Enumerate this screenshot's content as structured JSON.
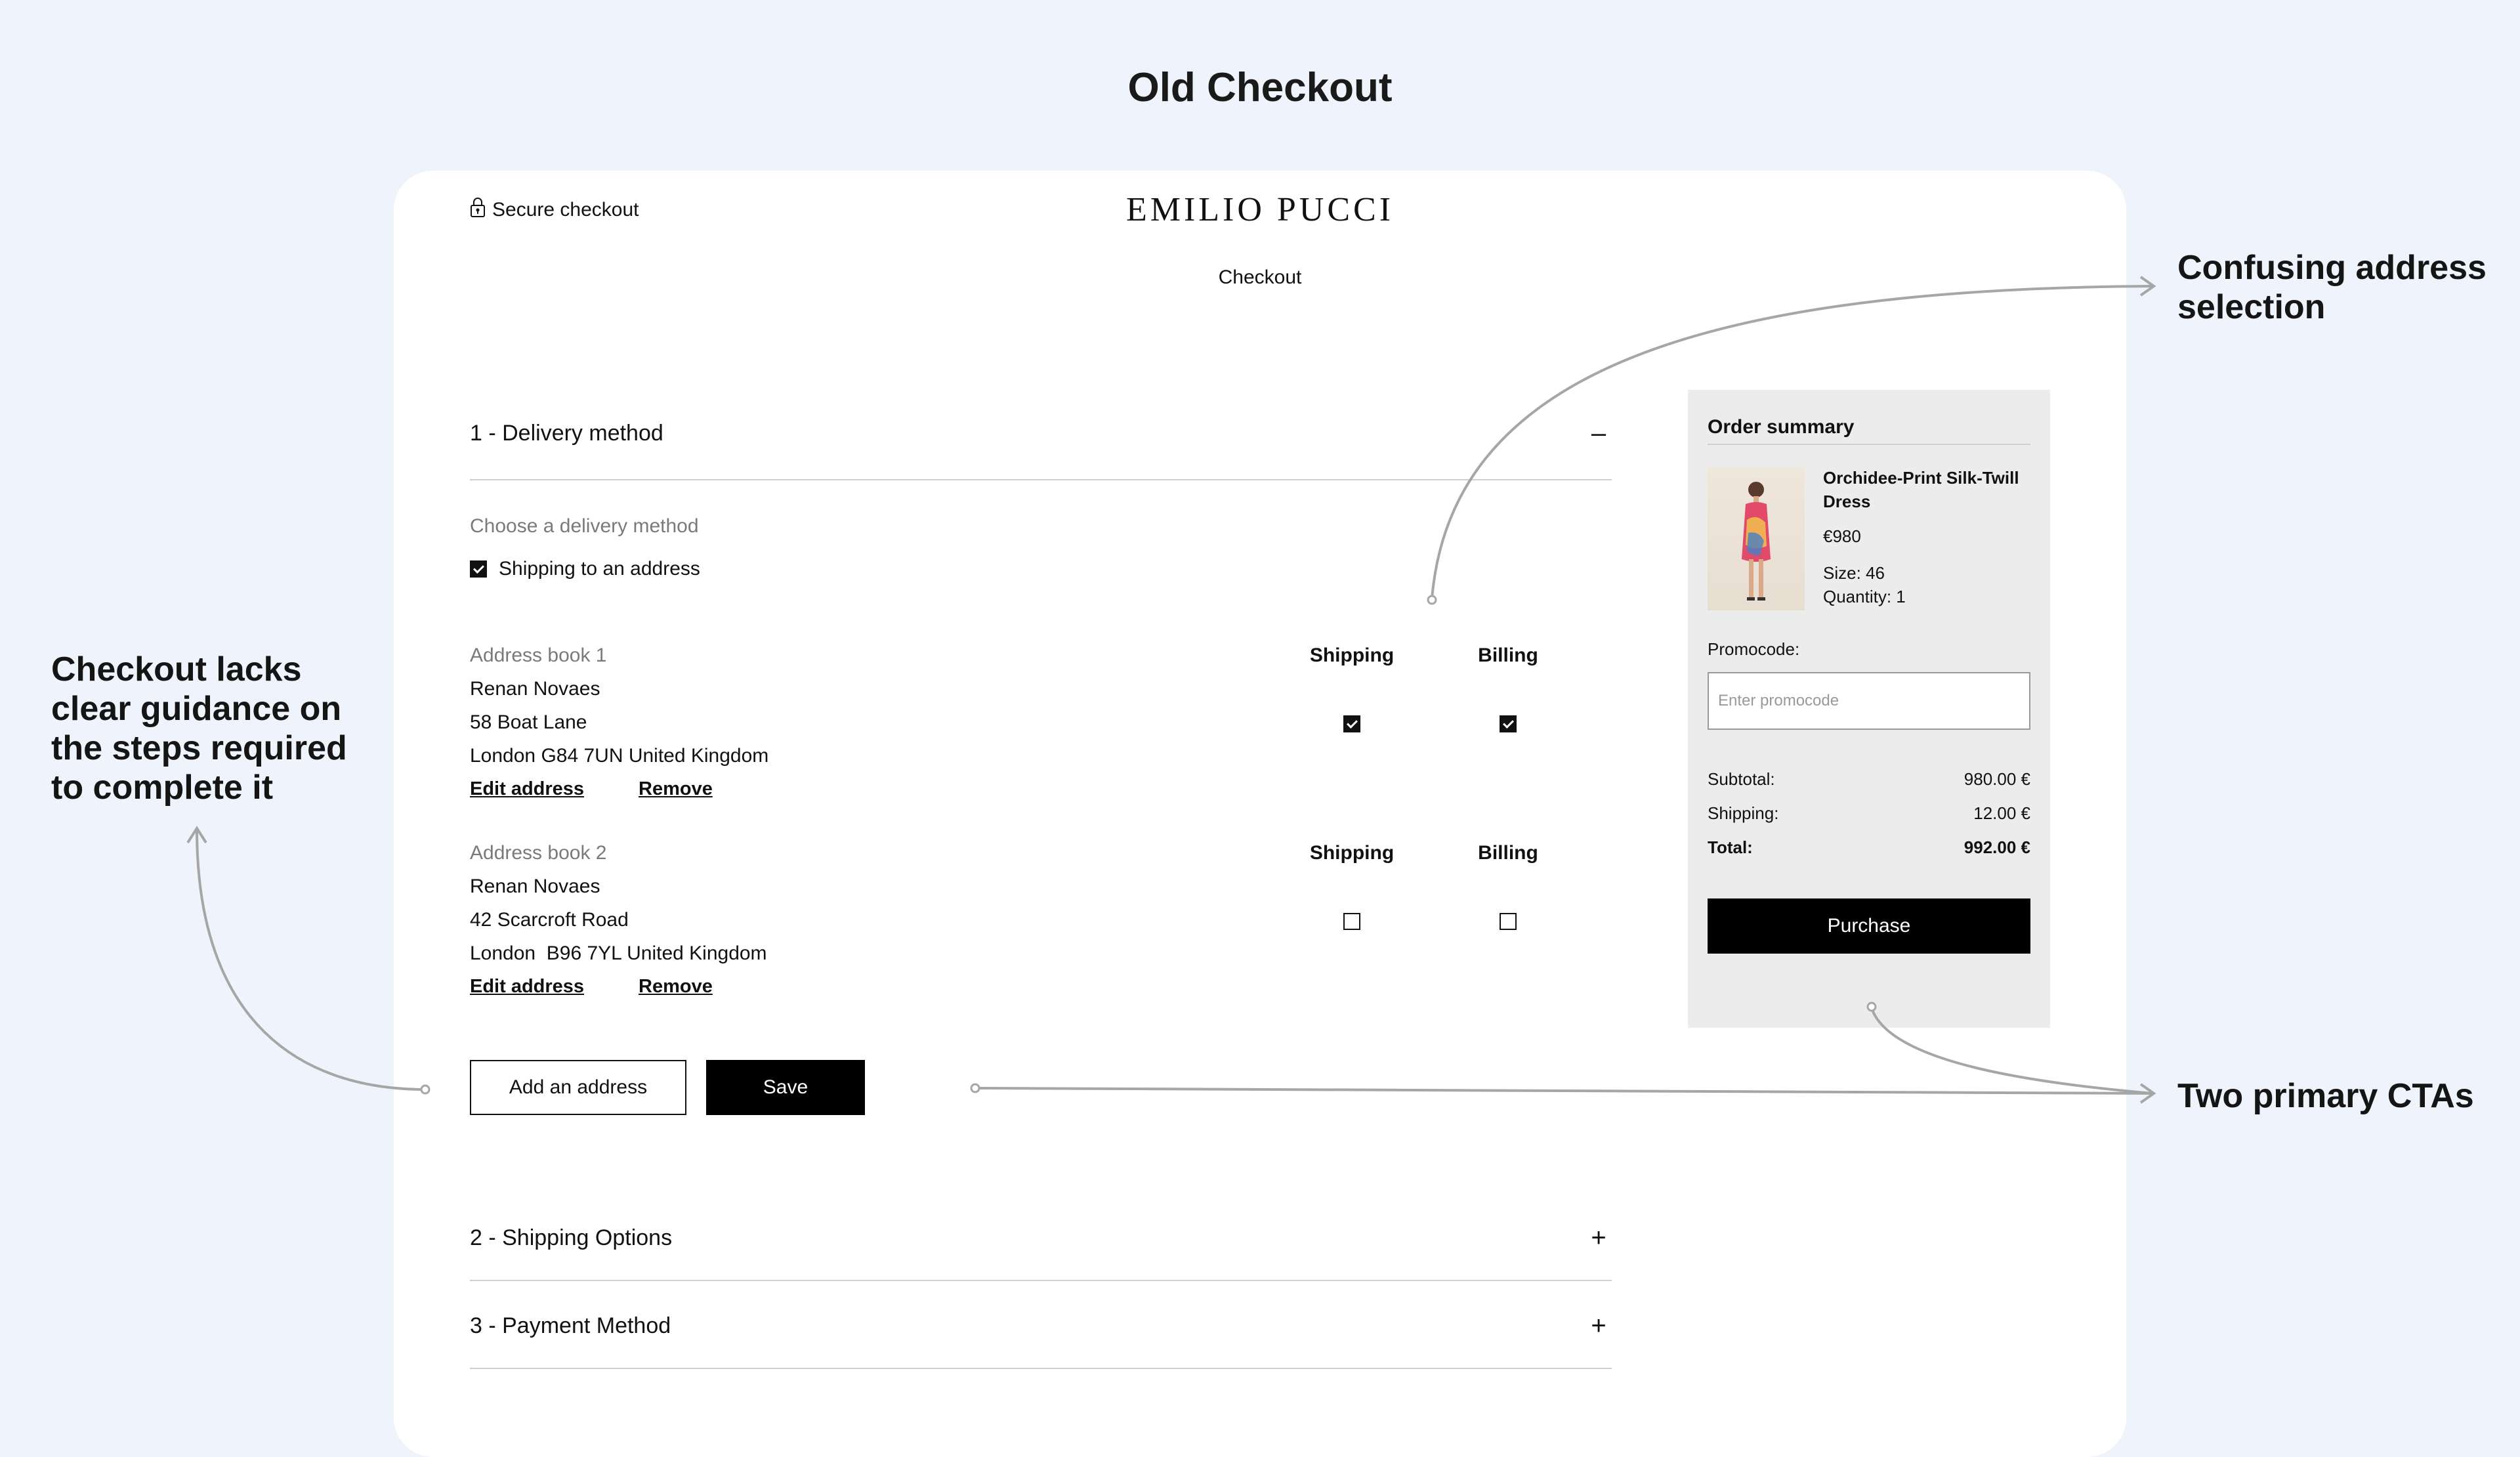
{
  "page_title": "Old Checkout",
  "notes": {
    "left": "Checkout lacks clear guidance on the steps required to complete it",
    "right_top": "Confusing address selection",
    "right_bottom": "Two primary CTAs"
  },
  "header": {
    "secure_label": "Secure checkout",
    "brand": "EMILIO PUCCI",
    "subtitle": "Checkout"
  },
  "sections": [
    {
      "label": "1 - Delivery method",
      "toggle": "–"
    },
    {
      "label": "2 - Shipping Options",
      "toggle": "+"
    },
    {
      "label": "3 - Payment Method",
      "toggle": "+"
    }
  ],
  "delivery": {
    "choose_label": "Choose a delivery method",
    "option_label": "Shipping to an address",
    "option_checked": true
  },
  "address_columns": {
    "shipping": "Shipping",
    "billing": "Billing"
  },
  "addresses": [
    {
      "heading": "Address book 1",
      "name": "Renan Novaes",
      "line1": "58 Boat Lane",
      "line2": "London G84 7UN United Kingdom",
      "edit": "Edit address",
      "remove": "Remove",
      "shipping_checked": true,
      "billing_checked": true
    },
    {
      "heading": "Address book 2",
      "name": "Renan Novaes",
      "line1": "42 Scarcroft Road",
      "line2": "London  B96 7YL United Kingdom",
      "edit": "Edit address",
      "remove": "Remove",
      "shipping_checked": false,
      "billing_checked": false
    }
  ],
  "buttons": {
    "add_address": "Add an address",
    "save": "Save"
  },
  "summary": {
    "title": "Order summary",
    "product_name": "Orchidee-Print Silk-Twill Dress",
    "price": "€980",
    "size": "Size: 46",
    "quantity": "Quantity: 1",
    "promo_label": "Promocode:",
    "promo_placeholder": "Enter promocode",
    "promo_value": "",
    "subtotal_label": "Subtotal:",
    "subtotal_value": "980.00 €",
    "shipping_label": "Shipping:",
    "shipping_value": "12.00 €",
    "total_label": "Total:",
    "total_value": "992.00 €",
    "purchase": "Purchase"
  }
}
